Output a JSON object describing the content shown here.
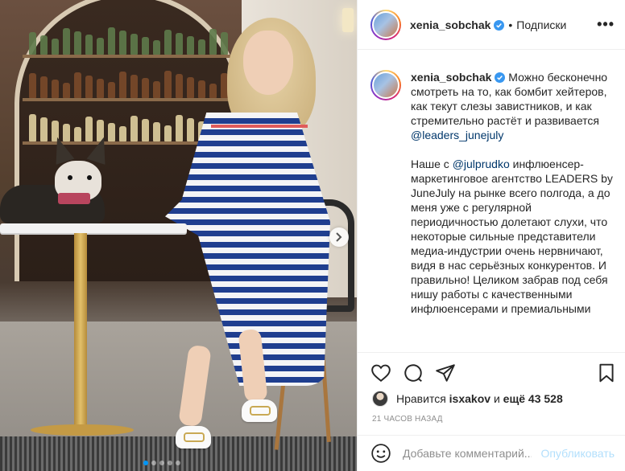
{
  "post": {
    "username": "xenia_sobchak",
    "follow_label": "Подписки",
    "separator": "•",
    "more_label": "•••",
    "caption_parts": [
      {
        "type": "text",
        "value": " Можно бесконечно смотреть на то, как бомбит хейтеров, как текут слезы завистников, и как стремительно растёт и развивается "
      },
      {
        "type": "mention",
        "value": "@leaders_junejuly"
      },
      {
        "type": "text",
        "value": "\n\nНаше с "
      },
      {
        "type": "mention",
        "value": "@julprudko"
      },
      {
        "type": "text",
        "value": " инфлюенсер-маркетинговое агентство LEADERS by JuneJuly на рынке всего полгода, а до меня уже с регулярной периодичностью долетают слухи, что некоторые сильные представители медиа-индустрии очень нервничают, видя в нас серьёзных конкурентов. И правильно! Целиком забрав под себя нишу работы с качественными инфлюенсерами и премиальными"
      }
    ],
    "likes": {
      "prefix": "Нравится",
      "user": "isxakov",
      "middle": "и",
      "more": "ещё 43 528"
    },
    "time_ago": "21 часов назад",
    "comment_placeholder": "Добавьте комментарий...",
    "publish_label": "Опубликовать",
    "carousel": {
      "total": 5,
      "active": 0
    }
  },
  "icons": {
    "verified": "verified-badge-icon",
    "like": "heart-icon",
    "comment": "comment-icon",
    "share": "paper-plane-icon",
    "save": "bookmark-icon",
    "emoji": "smiley-icon",
    "next": "chevron-right-icon"
  },
  "colors": {
    "verified_blue": "#3897f0",
    "mention": "#00376b",
    "publish_disabled": "#b2dffc",
    "dot_active": "#0095f6"
  }
}
